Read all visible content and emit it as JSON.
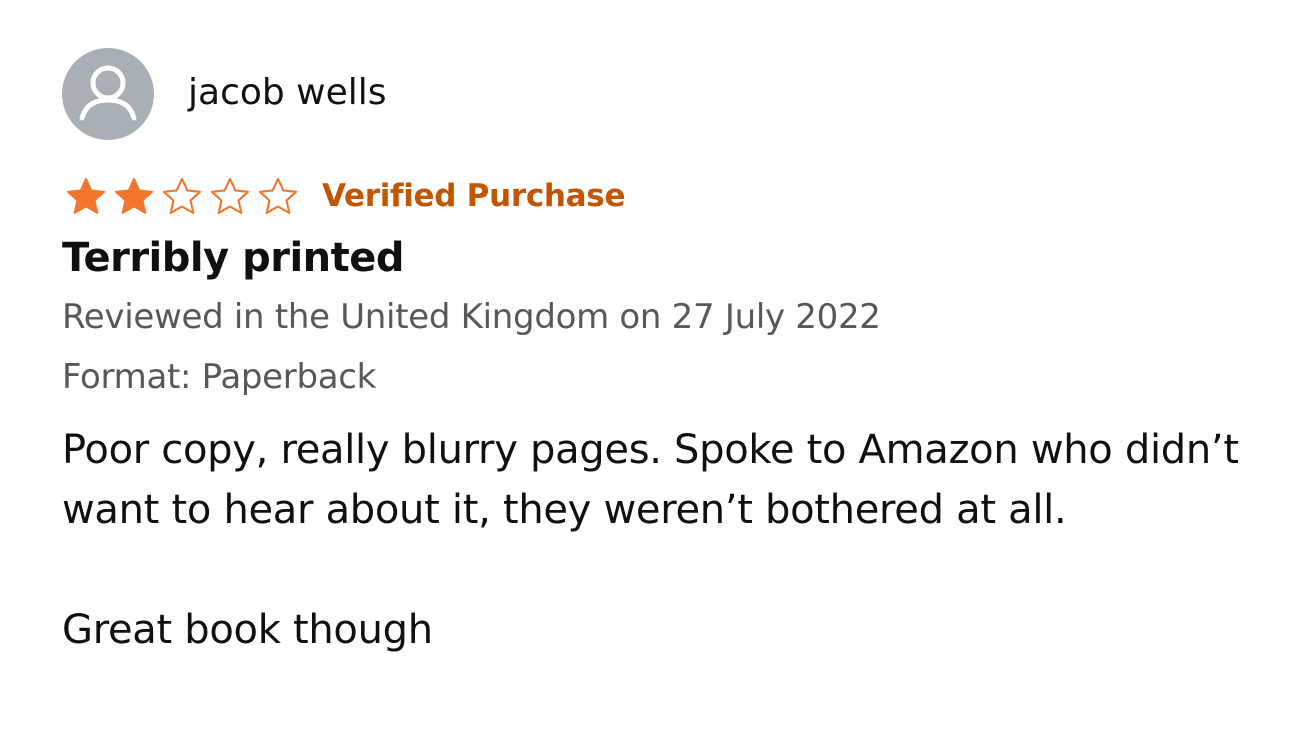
{
  "review": {
    "author": {
      "name": "jacob wells",
      "avatar_icon": "default-user-avatar-icon"
    },
    "rating": {
      "value": 2,
      "max": 5,
      "filled_color": "#f3762c",
      "empty_color": "#f3762c"
    },
    "verified_label": "Verified Purchase",
    "title": "Terribly printed",
    "reviewed_line": "Reviewed in the United Kingdom on 27 July 2022",
    "format_line": "Format: Paperback",
    "body": "Poor copy, really blurry pages. Spoke to Amazon who didn’t want to hear about it, they weren’t bothered at all.\n\nGreat book though",
    "colors": {
      "accent": "#c45500",
      "text": "#0f1111",
      "muted": "#565959",
      "avatar_bg": "#a9b0b5"
    }
  }
}
